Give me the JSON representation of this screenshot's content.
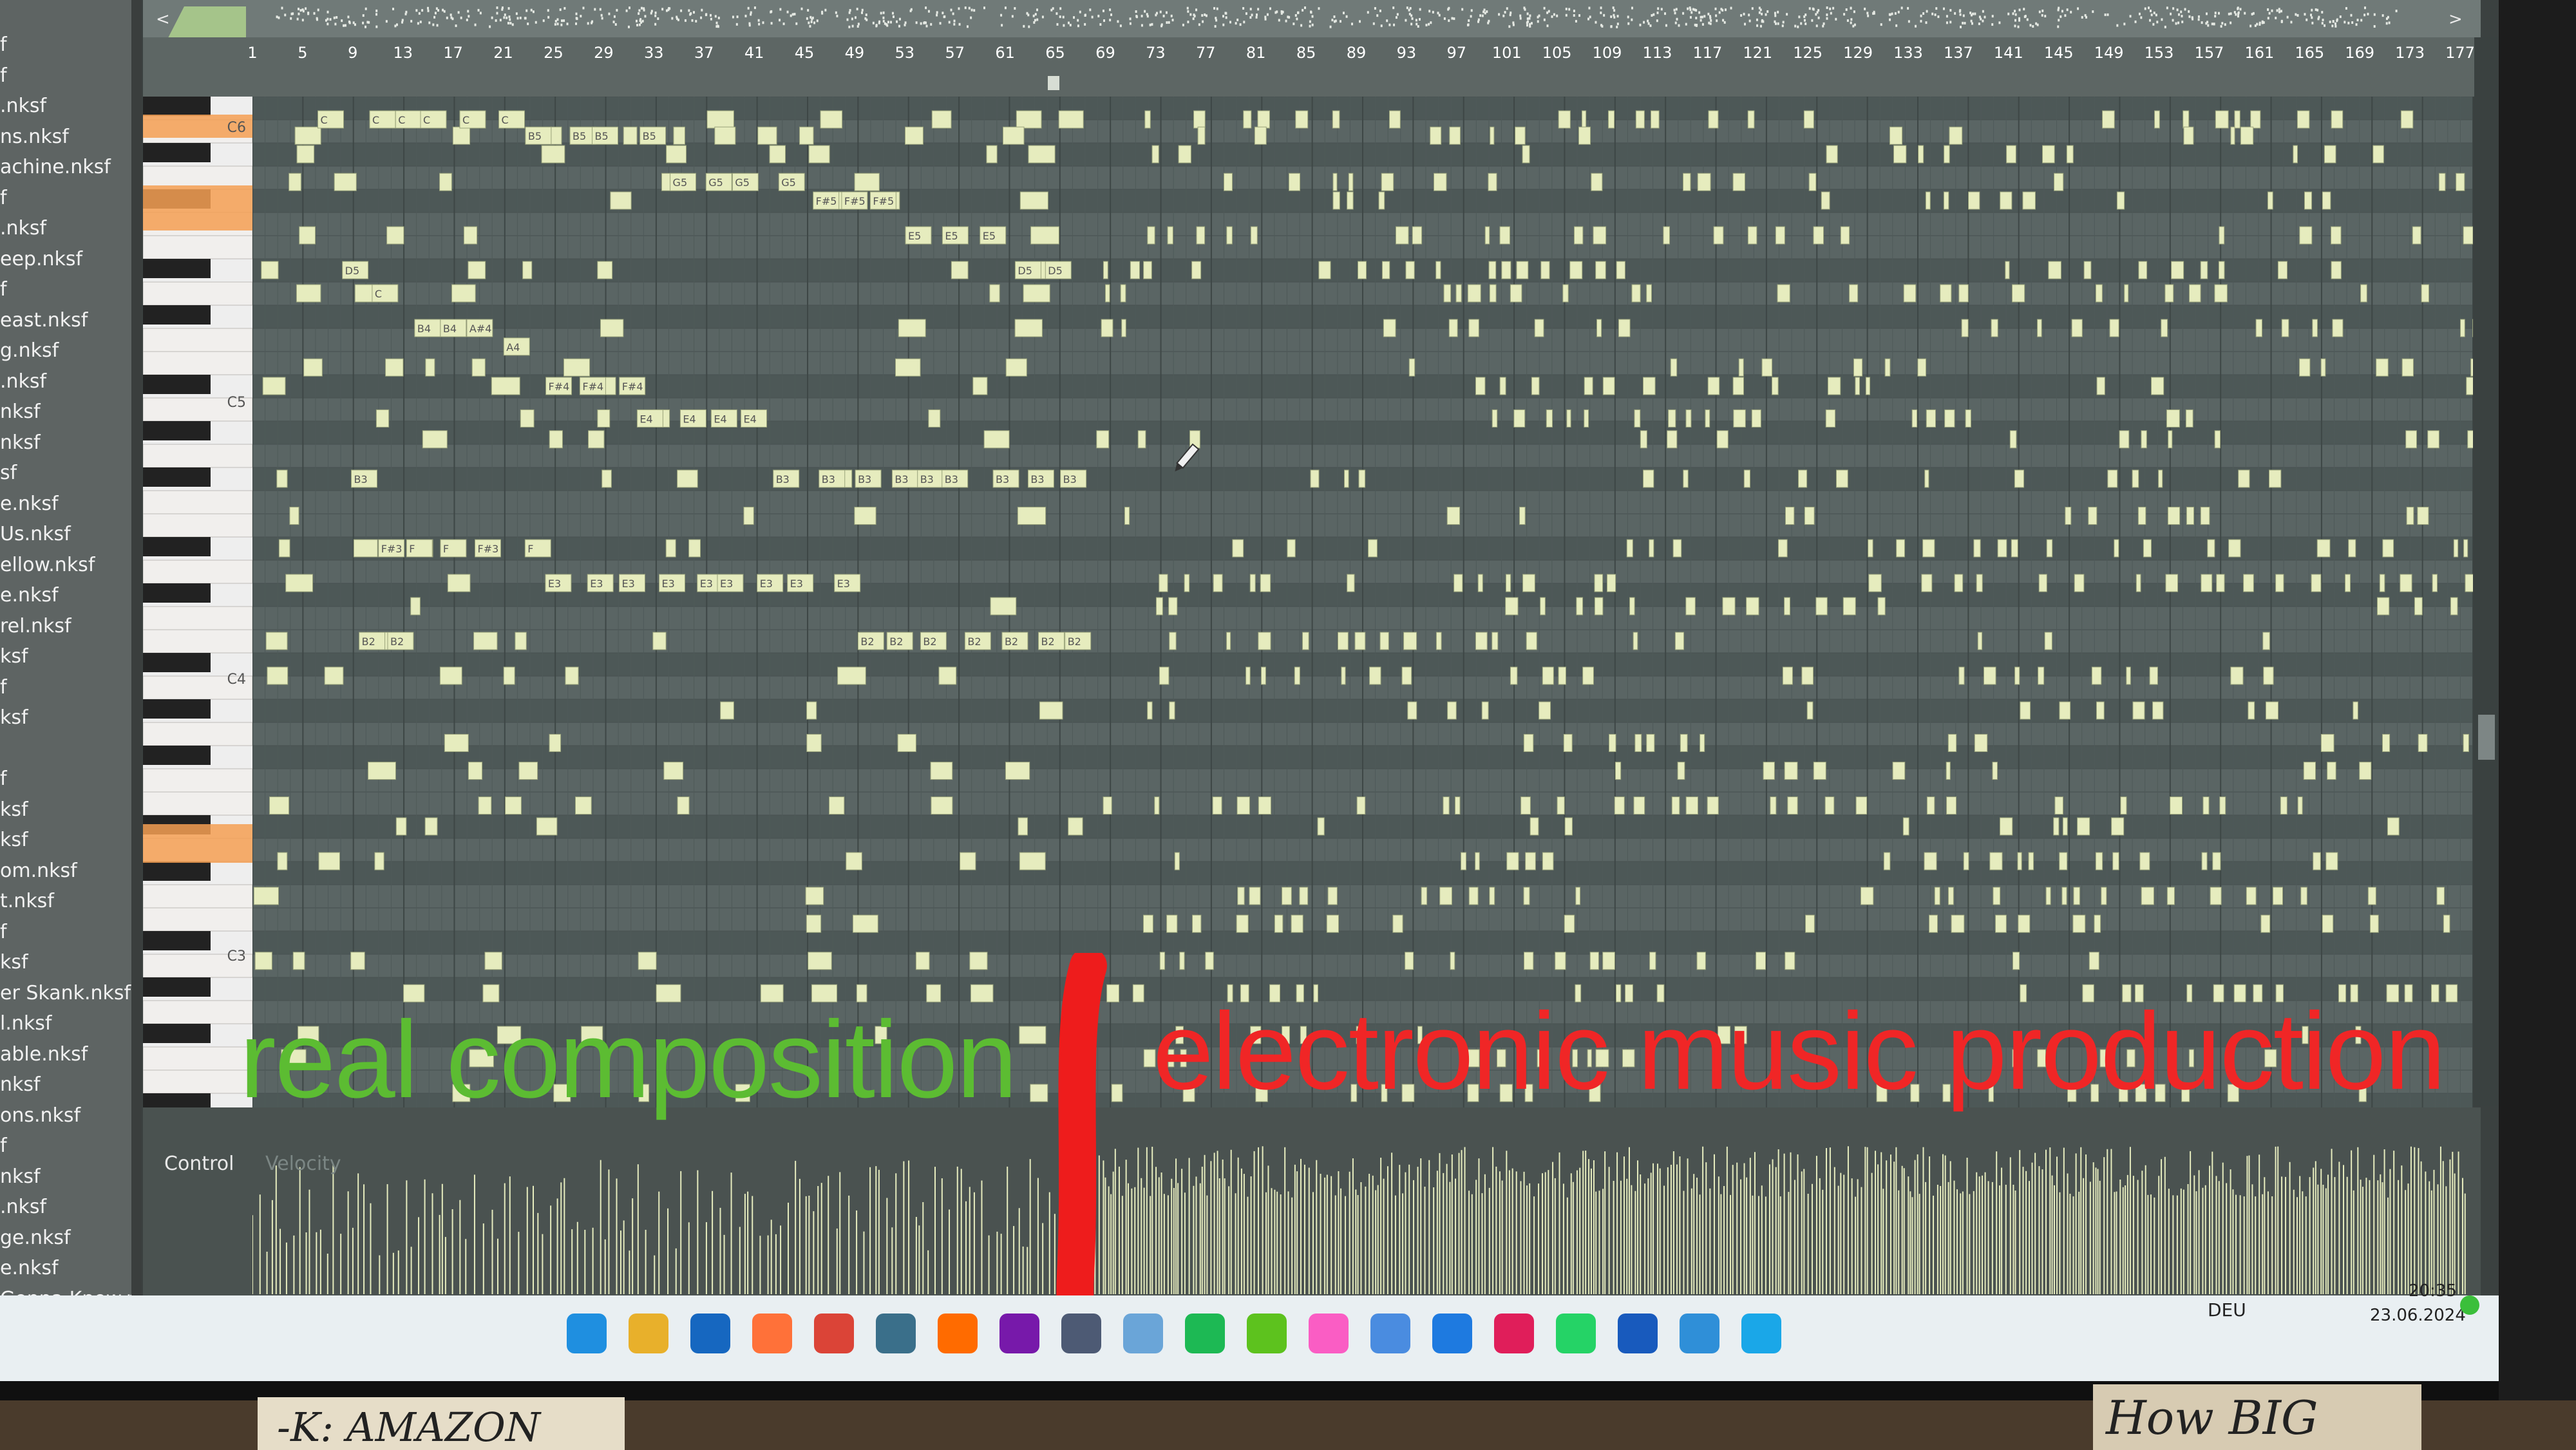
{
  "browser": {
    "items": [
      "f",
      "f",
      ".nksf",
      "ns.nksf",
      "achine.nksf",
      "f",
      ".nksf",
      "eep.nksf",
      "f",
      "east.nksf",
      "g.nksf",
      ".nksf",
      "nksf",
      "nksf",
      "sf",
      "e.nksf",
      "Us.nksf",
      "ellow.nksf",
      "e.nksf",
      "rel.nksf",
      "ksf",
      "f",
      "ksf",
      "",
      "f",
      "ksf",
      "ksf",
      "om.nksf",
      "t.nksf",
      "f",
      "ksf",
      "er Skank.nksf",
      "l.nksf",
      "able.nksf",
      "nksf",
      "ons.nksf",
      "f",
      "nksf",
      ".nksf",
      "ge.nksf",
      "e.nksf",
      "Gonna Know.nksf"
    ]
  },
  "piano_roll": {
    "ruler": [
      "1",
      "5",
      "9",
      "13",
      "17",
      "21",
      "25",
      "29",
      "33",
      "37",
      "41",
      "45",
      "49",
      "53",
      "57",
      "61",
      "65",
      "69",
      "73",
      "77",
      "81",
      "85",
      "89",
      "93",
      "97",
      "101",
      "105",
      "109",
      "113",
      "117",
      "121",
      "125",
      "129",
      "133",
      "137",
      "141",
      "145",
      "149",
      "153",
      "157",
      "161",
      "165",
      "169",
      "173",
      "177"
    ],
    "octave_labels": [
      "C6",
      "C5",
      "C4",
      "C3"
    ],
    "note_labels": [
      "C",
      "C",
      "C",
      "C",
      "C",
      "C",
      "B5",
      "B5",
      "B5",
      "B5",
      "G5",
      "G5",
      "G5",
      "G5",
      "F#5",
      "F#5",
      "F#5",
      "E5",
      "E5",
      "E5",
      "D5",
      "D5",
      "D5",
      "C",
      "B4",
      "B4",
      "A#4",
      "A4",
      "F#4",
      "F#4",
      "F#4",
      "E4",
      "E4",
      "E4",
      "E4",
      "B3",
      "B3",
      "B3",
      "B3",
      "B3",
      "B3",
      "B3",
      "B3",
      "B3",
      "B3",
      "F#3",
      "F",
      "F",
      "F#3",
      "F",
      "E3",
      "E3",
      "E3",
      "E3",
      "E3",
      "E3",
      "E3",
      "E3",
      "E3",
      "B2",
      "B2",
      "B2",
      "B2",
      "B2",
      "B2",
      "B2",
      "B2",
      "B2"
    ],
    "control_label": "Control",
    "velocity_label": "Velocity"
  },
  "annotations": {
    "left": "real composition",
    "right": "electronic music production",
    "left_color": "#5cbc32",
    "right_color": "#f02626"
  },
  "taskbar": {
    "icons": [
      "windows-start",
      "file-explorer",
      "outlook",
      "firefox",
      "chrome",
      "live",
      "fl-studio",
      "onenote",
      "calculator",
      "photos",
      "spotify",
      "xbox",
      "itunes",
      "chrome-remote",
      "trello",
      "slack",
      "whatsapp",
      "word",
      "mu",
      "prime-video"
    ],
    "language": "DEU",
    "time": "20:35",
    "date": "23.06.2024"
  },
  "desk_notes": {
    "left": "-K:  AMAZON",
    "right": "How BIG"
  }
}
